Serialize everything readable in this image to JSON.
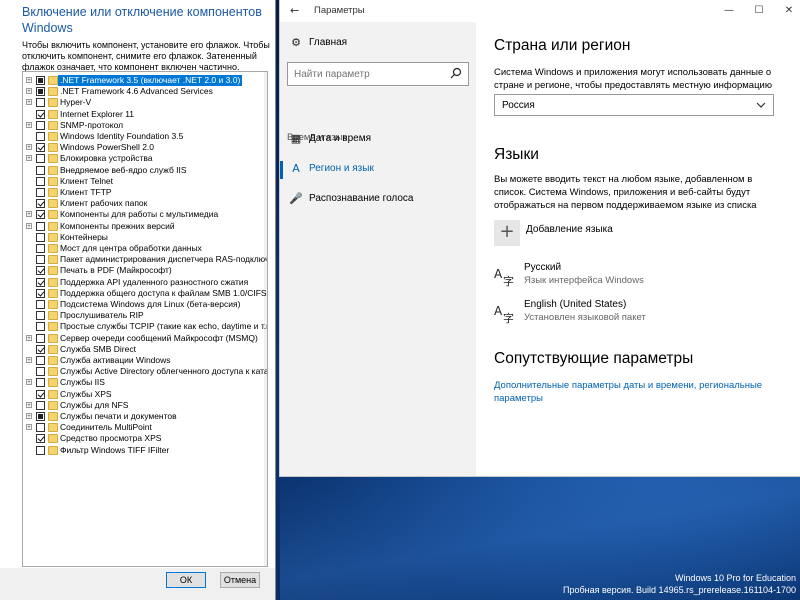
{
  "features": {
    "title": "Включение или отключение компонентов Windows",
    "description": "Чтобы включить компонент, установите его флажок. Чтобы отключить компонент, снимите его флажок. Затененный флажок означает, что компонент включен частично.",
    "items": [
      {
        "label": ".NET Framework 3.5 (включает .NET 2.0 и 3.0)",
        "state": "partial",
        "expandable": true,
        "selected": true
      },
      {
        "label": ".NET Framework 4.6 Advanced Services",
        "state": "partial",
        "expandable": true
      },
      {
        "label": "Hyper-V",
        "state": "unchecked",
        "expandable": true
      },
      {
        "label": "Internet Explorer 11",
        "state": "checked",
        "expandable": false
      },
      {
        "label": "SNMP-протокол",
        "state": "unchecked",
        "expandable": true
      },
      {
        "label": "Windows Identity Foundation 3.5",
        "state": "unchecked",
        "expandable": false
      },
      {
        "label": "Windows PowerShell 2.0",
        "state": "checked",
        "expandable": true
      },
      {
        "label": "Блокировка устройства",
        "state": "unchecked",
        "expandable": true
      },
      {
        "label": "Внедряемое веб-ядро служб IIS",
        "state": "unchecked",
        "expandable": false
      },
      {
        "label": "Клиент Telnet",
        "state": "unchecked",
        "expandable": false
      },
      {
        "label": "Клиент TFTP",
        "state": "unchecked",
        "expandable": false
      },
      {
        "label": "Клиент рабочих папок",
        "state": "checked",
        "expandable": false
      },
      {
        "label": "Компоненты для работы с мультимедиа",
        "state": "checked",
        "expandable": true
      },
      {
        "label": "Компоненты прежних версий",
        "state": "unchecked",
        "expandable": true
      },
      {
        "label": "Контейнеры",
        "state": "unchecked",
        "expandable": false
      },
      {
        "label": "Мост для центра обработки данных",
        "state": "unchecked",
        "expandable": false
      },
      {
        "label": "Пакет администрирования диспетчера RAS-подключений (CMAK)",
        "state": "unchecked",
        "expandable": false
      },
      {
        "label": "Печать в PDF (Майкрософт)",
        "state": "checked",
        "expandable": false
      },
      {
        "label": "Поддержка API удаленного разностного сжатия",
        "state": "checked",
        "expandable": false
      },
      {
        "label": "Поддержка общего доступа к файлам SMB 1.0/CIFS",
        "state": "checked",
        "expandable": false
      },
      {
        "label": "Подсистема Windows для Linux (бета-версия)",
        "state": "unchecked",
        "expandable": false
      },
      {
        "label": "Прослушиватель RIP",
        "state": "unchecked",
        "expandable": false
      },
      {
        "label": "Простые службы TCPIP (такие как echo, daytime и т.п.)",
        "state": "unchecked",
        "expandable": false
      },
      {
        "label": "Сервер очереди сообщений Майкрософт (MSMQ)",
        "state": "unchecked",
        "expandable": true
      },
      {
        "label": "Служба SMB Direct",
        "state": "checked",
        "expandable": false
      },
      {
        "label": "Служба активации Windows",
        "state": "unchecked",
        "expandable": true
      },
      {
        "label": "Службы Active Directory облегченного доступа к каталогам",
        "state": "unchecked",
        "expandable": false
      },
      {
        "label": "Службы IIS",
        "state": "unchecked",
        "expandable": true
      },
      {
        "label": "Службы XPS",
        "state": "checked",
        "expandable": false
      },
      {
        "label": "Службы для NFS",
        "state": "unchecked",
        "expandable": true
      },
      {
        "label": "Службы печати и документов",
        "state": "partial",
        "expandable": true
      },
      {
        "label": "Соединитель MultiPoint",
        "state": "unchecked",
        "expandable": true
      },
      {
        "label": "Средство просмотра XPS",
        "state": "checked",
        "expandable": false
      },
      {
        "label": "Фильтр Windows TIFF IFilter",
        "state": "unchecked",
        "expandable": false
      }
    ],
    "ok_label": "ОК",
    "cancel_label": "Отмена"
  },
  "settings": {
    "app_title": "Параметры",
    "nav": {
      "home_label": "Главная",
      "search_placeholder": "Найти параметр",
      "group_label": "Время и язык",
      "items": [
        {
          "label": "Дата и время",
          "icon": "calendar-clock-icon"
        },
        {
          "label": "Регион и язык",
          "icon": "region-language-icon",
          "active": true
        },
        {
          "label": "Распознавание голоса",
          "icon": "microphone-icon"
        }
      ]
    },
    "region": {
      "heading": "Страна или регион",
      "description": "Система Windows и приложения могут использовать данные о стране и регионе, чтобы предоставлять местную информацию",
      "selected_country": "Россия"
    },
    "languages": {
      "heading": "Языки",
      "description": "Вы можете вводить текст на любом языке, добавленном в список. Система Windows, приложения и веб-сайты будут отображаться на первом поддерживаемом языке из списка",
      "add_label": "Добавление языка",
      "list": [
        {
          "name": "Русский",
          "sub": "Язык интерфейса Windows"
        },
        {
          "name": "English (United States)",
          "sub": "Установлен языковой пакет"
        }
      ]
    },
    "related": {
      "heading": "Сопутствующие параметры",
      "link": "Дополнительные параметры даты и времени, региональные параметры"
    }
  },
  "watermark": {
    "line1": "Windows 10 Pro for Education",
    "line2": "Пробная версия. Build 14965.rs_prerelease.161104-1700"
  },
  "colors": {
    "accent": "#0063b1",
    "dialog_title": "#1c5aa8",
    "selection": "#0078d7"
  }
}
